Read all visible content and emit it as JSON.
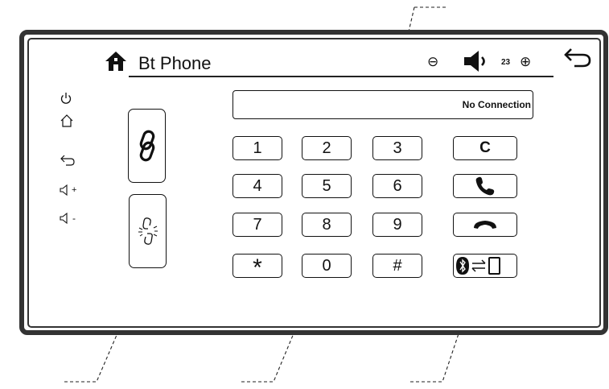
{
  "header": {
    "title": "Bt Phone",
    "volume_level": "23"
  },
  "icons": {
    "home": "home-icon",
    "volume_down": "volume-down-icon",
    "volume_up": "volume-up-icon",
    "speaker": "speaker-icon",
    "back": "back-arrow-icon",
    "side": [
      "power-icon",
      "home-outline-icon",
      "back-icon",
      "volume-up-icon",
      "volume-down-icon"
    ],
    "link": "link-icon",
    "unlink": "unlink-icon",
    "call": "call-icon",
    "hangup": "hang-up-icon",
    "bt_transfer": "bluetooth-transfer-icon"
  },
  "display": {
    "status": "No Connection"
  },
  "keypad": {
    "keys": [
      "1",
      "2",
      "3",
      "4",
      "5",
      "6",
      "7",
      "8",
      "9",
      "*",
      "0",
      "#"
    ],
    "clear": "C"
  },
  "side_labels": {
    "vol_up_sign": "+",
    "vol_down_sign": "-"
  },
  "colors": {
    "frame": "#333333",
    "ink": "#111111"
  }
}
